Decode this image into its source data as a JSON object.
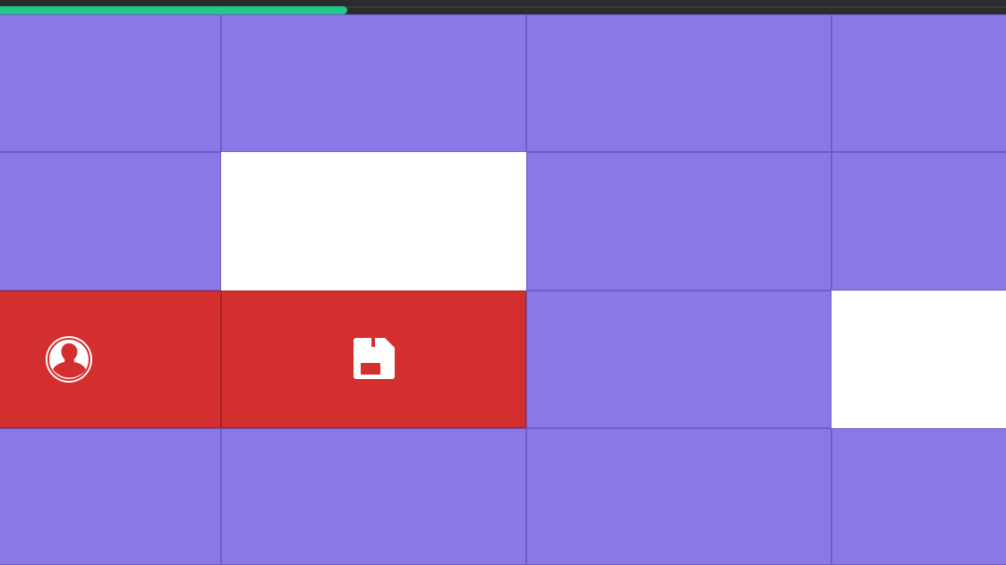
{
  "progress": {
    "fraction": 0.345,
    "fill_color": "#1fc98a"
  },
  "colors": {
    "hidden_tile": "#8a78e6",
    "revealed_tile": "#d42f2f",
    "empty_tile": "#ffffff",
    "icon": "#ffffff"
  },
  "board": {
    "rows": [
      [
        {
          "state": "hidden"
        },
        {
          "state": "hidden"
        },
        {
          "state": "hidden"
        },
        {
          "state": "hidden"
        }
      ],
      [
        {
          "state": "hidden"
        },
        {
          "state": "empty"
        },
        {
          "state": "hidden"
        },
        {
          "state": "hidden"
        }
      ],
      [
        {
          "state": "revealed",
          "icon": "user-icon"
        },
        {
          "state": "revealed",
          "icon": "save-icon"
        },
        {
          "state": "hidden"
        },
        {
          "state": "empty"
        }
      ],
      [
        {
          "state": "hidden"
        },
        {
          "state": "hidden"
        },
        {
          "state": "hidden"
        },
        {
          "state": "hidden"
        }
      ]
    ]
  }
}
